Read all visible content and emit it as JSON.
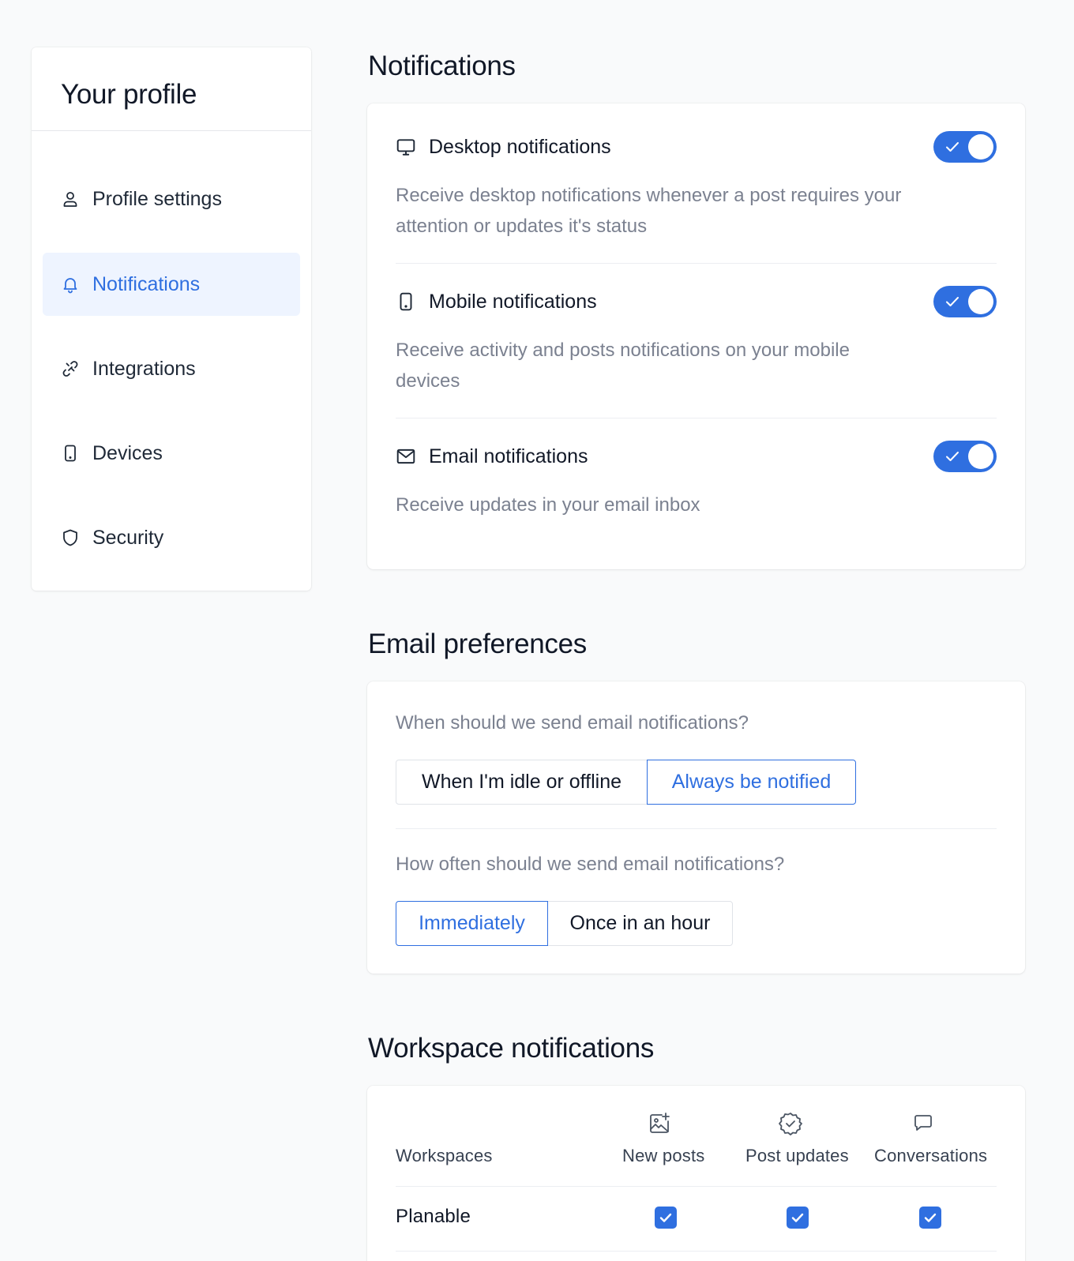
{
  "sidebar": {
    "title": "Your profile",
    "items": [
      {
        "label": "Profile settings",
        "icon": "user-icon",
        "active": false
      },
      {
        "label": "Notifications",
        "icon": "bell-icon",
        "active": true
      },
      {
        "label": "Integrations",
        "icon": "link-icon",
        "active": false
      },
      {
        "label": "Devices",
        "icon": "mobile-icon",
        "active": false
      },
      {
        "label": "Security",
        "icon": "shield-icon",
        "active": false
      }
    ]
  },
  "notifications": {
    "title": "Notifications",
    "items": [
      {
        "title": "Desktop notifications",
        "icon": "monitor-icon",
        "description": "Receive desktop notifications whenever a post requires your attention or updates it's status",
        "enabled": true
      },
      {
        "title": "Mobile notifications",
        "icon": "mobile-icon",
        "description": "Receive activity and posts notifications on your mobile devices",
        "enabled": true
      },
      {
        "title": "Email notifications",
        "icon": "mail-icon",
        "description": "Receive updates in your email inbox",
        "enabled": true
      }
    ]
  },
  "email_preferences": {
    "title": "Email preferences",
    "when_question": "When should we send email notifications?",
    "when_options": [
      "When I'm idle or offline",
      "Always be notified"
    ],
    "when_selected": "Always be notified",
    "frequency_question": "How often should we send email notifications?",
    "frequency_options": [
      "Immediately",
      "Once in an hour"
    ],
    "frequency_selected": "Immediately"
  },
  "workspace_notifications": {
    "title": "Workspace notifications",
    "column_header": "Workspaces",
    "columns": [
      {
        "label": "New posts",
        "icon": "image-plus-icon"
      },
      {
        "label": "Post updates",
        "icon": "badge-check-icon"
      },
      {
        "label": "Conversations",
        "icon": "chat-bubble-icon"
      }
    ],
    "rows": [
      {
        "name": "Planable",
        "new_posts": true,
        "post_updates": true,
        "conversations": true
      }
    ]
  },
  "colors": {
    "accent": "#2f6fe0",
    "active_bg": "#eef4ff",
    "muted_text": "#7b8190",
    "page_bg": "#f9fafb"
  }
}
